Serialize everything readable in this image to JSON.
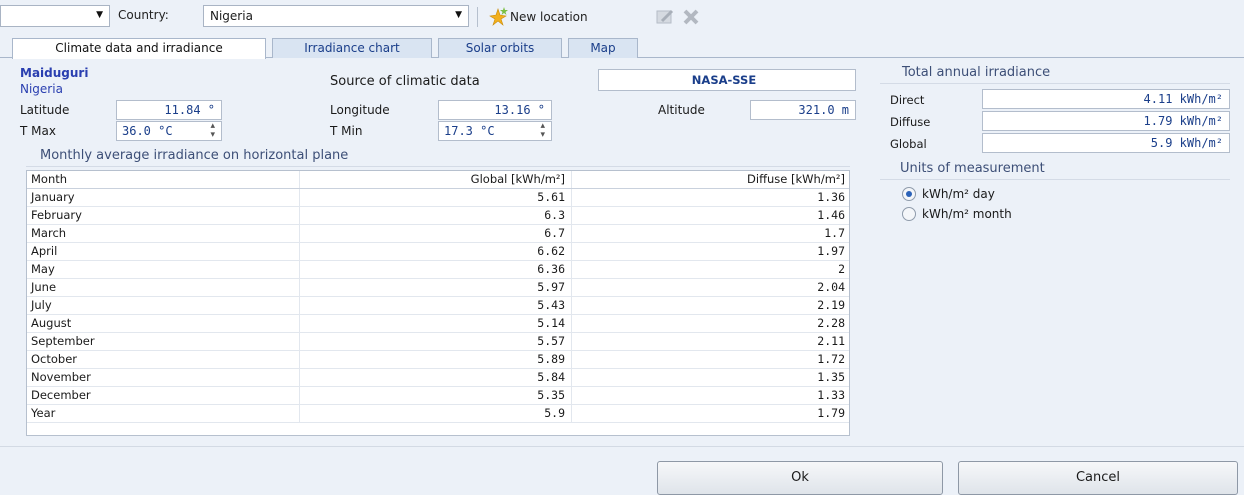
{
  "toolbar": {
    "location_combo_value": "",
    "country_label": "Country:",
    "country_value": "Nigeria",
    "new_location_label": "New location"
  },
  "tabs": [
    {
      "label": "Climate data and irradiance",
      "active": true
    },
    {
      "label": "Irradiance chart",
      "active": false
    },
    {
      "label": "Solar orbits",
      "active": false
    },
    {
      "label": "Map",
      "active": false
    }
  ],
  "location": {
    "city": "Maiduguri",
    "country": "Nigeria",
    "source_label": "Source of climatic data",
    "source_value": "NASA-SSE",
    "latitude_label": "Latitude",
    "latitude_value": "11.84 °",
    "longitude_label": "Longitude",
    "longitude_value": "13.16 °",
    "altitude_label": "Altitude",
    "altitude_value": "321.0 m",
    "tmax_label": "T Max",
    "tmax_value": "36.0 °C",
    "tmin_label": "T Min",
    "tmin_value": "17.3 °C"
  },
  "monthly": {
    "title": "Monthly average irradiance on horizontal plane",
    "headers": [
      "Month",
      "Global [kWh/m²]",
      "Diffuse [kWh/m²]"
    ],
    "rows": [
      [
        "January",
        "5.61",
        "1.36"
      ],
      [
        "February",
        "6.3",
        "1.46"
      ],
      [
        "March",
        "6.7",
        "1.7"
      ],
      [
        "April",
        "6.62",
        "1.97"
      ],
      [
        "May",
        "6.36",
        "2"
      ],
      [
        "June",
        "5.97",
        "2.04"
      ],
      [
        "July",
        "5.43",
        "2.19"
      ],
      [
        "August",
        "5.14",
        "2.28"
      ],
      [
        "September",
        "5.57",
        "2.11"
      ],
      [
        "October",
        "5.89",
        "1.72"
      ],
      [
        "November",
        "5.84",
        "1.35"
      ],
      [
        "December",
        "5.35",
        "1.33"
      ],
      [
        "Year",
        "5.9",
        "1.79"
      ]
    ]
  },
  "annual": {
    "title": "Total annual irradiance",
    "direct_label": "Direct",
    "direct_value": "4.11 kWh/m²",
    "diffuse_label": "Diffuse",
    "diffuse_value": "1.79 kWh/m²",
    "global_label": "Global",
    "global_value": "5.9 kWh/m²"
  },
  "units": {
    "title": "Units of measurement",
    "options": [
      {
        "label": "kWh/m² day",
        "selected": true
      },
      {
        "label": "kWh/m² month",
        "selected": false
      }
    ]
  },
  "footer": {
    "ok_label": "Ok",
    "cancel_label": "Cancel"
  },
  "colors": {
    "accent_text": "#1a3e8a",
    "background": "#ecf1f8",
    "city_color": "#2a3fb0"
  }
}
